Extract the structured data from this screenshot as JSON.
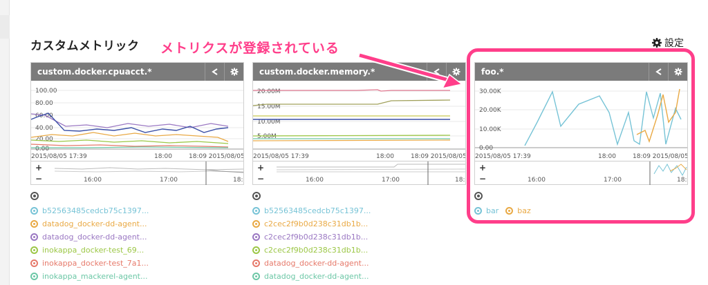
{
  "page": {
    "section_title": "カスタムメトリック",
    "settings_label": "設定",
    "annotation": "メトリクスが登録されている"
  },
  "colors": {
    "annotation": "#ff3e8a",
    "widget_header": "#7b7b7b",
    "s_blue": "#4a90c9",
    "s_teal": "#76c3d6",
    "s_orange": "#e9a944",
    "s_purple": "#9a77c2",
    "s_green": "#9cc746",
    "s_red": "#e6796a",
    "s_navy": "#3a4fa6",
    "s_olive": "#a0a05a"
  },
  "widgets": [
    {
      "title": "custom.docker.cpuacct.*",
      "y_ticks": [
        "100.00",
        "80.00",
        "60.00",
        "40.00",
        "20.00",
        "0.00"
      ],
      "x_labels": [
        "2015/08/05 17:39",
        "18:00",
        "18:09 2015/08/05"
      ],
      "nav_labels": [
        "16:00",
        "17:00",
        "18:"
      ],
      "legend": [
        {
          "label": "b52563485cedcb75c1397...",
          "color": "#76c3d6"
        },
        {
          "label": "datadog_docker-dd-agent...",
          "color": "#e9a944"
        },
        {
          "label": "datadog_docker-dd-agent...",
          "color": "#9a77c2"
        },
        {
          "label": "inokappa_docker-test_69...",
          "color": "#9cc746"
        },
        {
          "label": "inokappa_docker-test_7a1...",
          "color": "#e6796a"
        },
        {
          "label": "inokappa_mackerel-agent...",
          "color": "#6cc7a6"
        }
      ]
    },
    {
      "title": "custom.docker.memory.*",
      "y_ticks": [
        "20.00M",
        "15.00M",
        "10.00M",
        "5.00M"
      ],
      "x_labels": [
        "2015/08/05 17:39",
        "18:00",
        "18:09 2015/08/05"
      ],
      "nav_labels": [
        "16:00",
        "17:00",
        "18:"
      ],
      "legend": [
        {
          "label": "b52563485cedcb75c1397...",
          "color": "#76c3d6"
        },
        {
          "label": "c2cec2f9b0d238c31db1b...",
          "color": "#e9a944"
        },
        {
          "label": "c2cec2f9b0d238c31db1b...",
          "color": "#9a77c2"
        },
        {
          "label": "c2cec2f9b0d238c31db1b...",
          "color": "#9cc746"
        },
        {
          "label": "datadog_docker-dd-agent...",
          "color": "#e6796a"
        },
        {
          "label": "datadog_docker-dd-agent...",
          "color": "#6cc7a6"
        }
      ]
    },
    {
      "title": "foo.*",
      "y_ticks": [
        "30.00K",
        "20.00K",
        "10.00K",
        "0.00"
      ],
      "x_labels": [
        "2015/08/05 17:39",
        "18:00",
        "18:09 2015/08/05"
      ],
      "nav_labels": [
        "16:00",
        "17:00",
        "18:"
      ],
      "legend": [
        {
          "label": "bar",
          "color": "#76c3d6"
        },
        {
          "label": "baz",
          "color": "#e9a944"
        }
      ]
    }
  ]
}
